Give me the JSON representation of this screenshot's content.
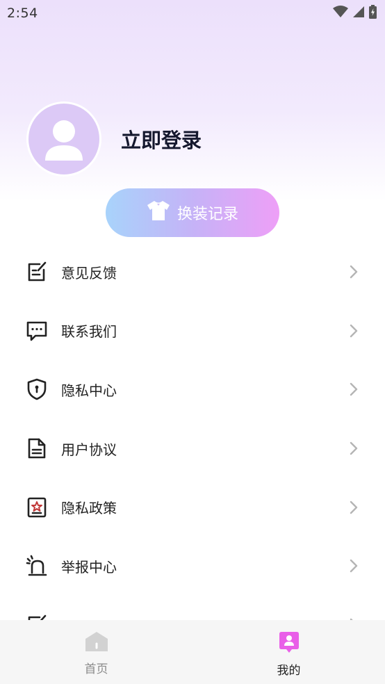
{
  "status_bar": {
    "time": "2:54"
  },
  "profile": {
    "login_label": "立即登录"
  },
  "outfit_button": {
    "label": "换装记录"
  },
  "menu": {
    "items": [
      {
        "label": "意见反馈",
        "icon": "feedback-icon"
      },
      {
        "label": "联系我们",
        "icon": "chat-icon"
      },
      {
        "label": "隐私中心",
        "icon": "shield-icon"
      },
      {
        "label": "用户协议",
        "icon": "document-icon"
      },
      {
        "label": "隐私政策",
        "icon": "badge-icon"
      },
      {
        "label": "举报中心",
        "icon": "alarm-icon"
      }
    ]
  },
  "tabbar": {
    "tabs": [
      {
        "label": "首页",
        "icon": "home-icon",
        "active": false
      },
      {
        "label": "我的",
        "icon": "profile-icon",
        "active": true
      }
    ]
  },
  "colors": {
    "accent_pink": "#e95fe8",
    "title_dark": "#15182e",
    "avatar_bg": "#dcc9f6"
  }
}
